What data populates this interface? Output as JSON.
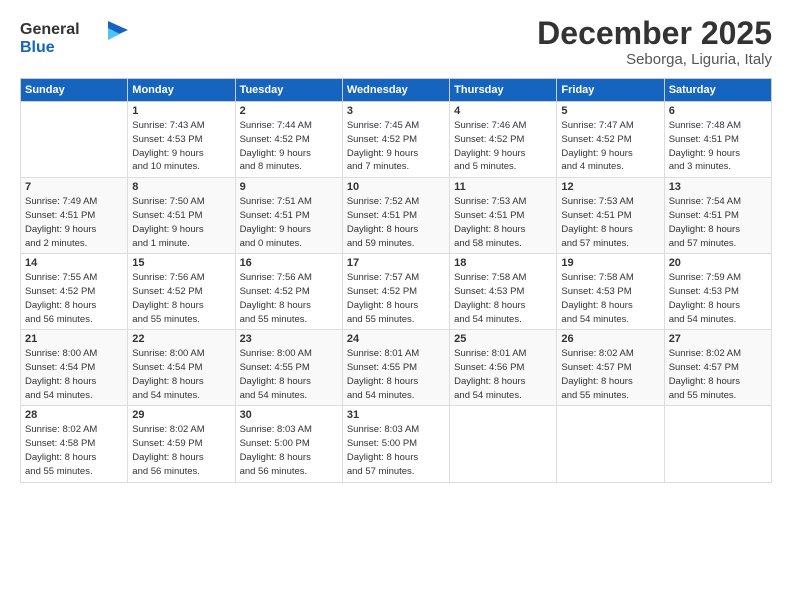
{
  "header": {
    "logo_line1": "General",
    "logo_line2": "Blue",
    "month": "December 2025",
    "location": "Seborga, Liguria, Italy"
  },
  "weekdays": [
    "Sunday",
    "Monday",
    "Tuesday",
    "Wednesday",
    "Thursday",
    "Friday",
    "Saturday"
  ],
  "weeks": [
    [
      {
        "day": "",
        "info": ""
      },
      {
        "day": "1",
        "info": "Sunrise: 7:43 AM\nSunset: 4:53 PM\nDaylight: 9 hours\nand 10 minutes."
      },
      {
        "day": "2",
        "info": "Sunrise: 7:44 AM\nSunset: 4:52 PM\nDaylight: 9 hours\nand 8 minutes."
      },
      {
        "day": "3",
        "info": "Sunrise: 7:45 AM\nSunset: 4:52 PM\nDaylight: 9 hours\nand 7 minutes."
      },
      {
        "day": "4",
        "info": "Sunrise: 7:46 AM\nSunset: 4:52 PM\nDaylight: 9 hours\nand 5 minutes."
      },
      {
        "day": "5",
        "info": "Sunrise: 7:47 AM\nSunset: 4:52 PM\nDaylight: 9 hours\nand 4 minutes."
      },
      {
        "day": "6",
        "info": "Sunrise: 7:48 AM\nSunset: 4:51 PM\nDaylight: 9 hours\nand 3 minutes."
      }
    ],
    [
      {
        "day": "7",
        "info": "Sunrise: 7:49 AM\nSunset: 4:51 PM\nDaylight: 9 hours\nand 2 minutes."
      },
      {
        "day": "8",
        "info": "Sunrise: 7:50 AM\nSunset: 4:51 PM\nDaylight: 9 hours\nand 1 minute."
      },
      {
        "day": "9",
        "info": "Sunrise: 7:51 AM\nSunset: 4:51 PM\nDaylight: 9 hours\nand 0 minutes."
      },
      {
        "day": "10",
        "info": "Sunrise: 7:52 AM\nSunset: 4:51 PM\nDaylight: 8 hours\nand 59 minutes."
      },
      {
        "day": "11",
        "info": "Sunrise: 7:53 AM\nSunset: 4:51 PM\nDaylight: 8 hours\nand 58 minutes."
      },
      {
        "day": "12",
        "info": "Sunrise: 7:53 AM\nSunset: 4:51 PM\nDaylight: 8 hours\nand 57 minutes."
      },
      {
        "day": "13",
        "info": "Sunrise: 7:54 AM\nSunset: 4:51 PM\nDaylight: 8 hours\nand 57 minutes."
      }
    ],
    [
      {
        "day": "14",
        "info": "Sunrise: 7:55 AM\nSunset: 4:52 PM\nDaylight: 8 hours\nand 56 minutes."
      },
      {
        "day": "15",
        "info": "Sunrise: 7:56 AM\nSunset: 4:52 PM\nDaylight: 8 hours\nand 55 minutes."
      },
      {
        "day": "16",
        "info": "Sunrise: 7:56 AM\nSunset: 4:52 PM\nDaylight: 8 hours\nand 55 minutes."
      },
      {
        "day": "17",
        "info": "Sunrise: 7:57 AM\nSunset: 4:52 PM\nDaylight: 8 hours\nand 55 minutes."
      },
      {
        "day": "18",
        "info": "Sunrise: 7:58 AM\nSunset: 4:53 PM\nDaylight: 8 hours\nand 54 minutes."
      },
      {
        "day": "19",
        "info": "Sunrise: 7:58 AM\nSunset: 4:53 PM\nDaylight: 8 hours\nand 54 minutes."
      },
      {
        "day": "20",
        "info": "Sunrise: 7:59 AM\nSunset: 4:53 PM\nDaylight: 8 hours\nand 54 minutes."
      }
    ],
    [
      {
        "day": "21",
        "info": "Sunrise: 8:00 AM\nSunset: 4:54 PM\nDaylight: 8 hours\nand 54 minutes."
      },
      {
        "day": "22",
        "info": "Sunrise: 8:00 AM\nSunset: 4:54 PM\nDaylight: 8 hours\nand 54 minutes."
      },
      {
        "day": "23",
        "info": "Sunrise: 8:00 AM\nSunset: 4:55 PM\nDaylight: 8 hours\nand 54 minutes."
      },
      {
        "day": "24",
        "info": "Sunrise: 8:01 AM\nSunset: 4:55 PM\nDaylight: 8 hours\nand 54 minutes."
      },
      {
        "day": "25",
        "info": "Sunrise: 8:01 AM\nSunset: 4:56 PM\nDaylight: 8 hours\nand 54 minutes."
      },
      {
        "day": "26",
        "info": "Sunrise: 8:02 AM\nSunset: 4:57 PM\nDaylight: 8 hours\nand 55 minutes."
      },
      {
        "day": "27",
        "info": "Sunrise: 8:02 AM\nSunset: 4:57 PM\nDaylight: 8 hours\nand 55 minutes."
      }
    ],
    [
      {
        "day": "28",
        "info": "Sunrise: 8:02 AM\nSunset: 4:58 PM\nDaylight: 8 hours\nand 55 minutes."
      },
      {
        "day": "29",
        "info": "Sunrise: 8:02 AM\nSunset: 4:59 PM\nDaylight: 8 hours\nand 56 minutes."
      },
      {
        "day": "30",
        "info": "Sunrise: 8:03 AM\nSunset: 5:00 PM\nDaylight: 8 hours\nand 56 minutes."
      },
      {
        "day": "31",
        "info": "Sunrise: 8:03 AM\nSunset: 5:00 PM\nDaylight: 8 hours\nand 57 minutes."
      },
      {
        "day": "",
        "info": ""
      },
      {
        "day": "",
        "info": ""
      },
      {
        "day": "",
        "info": ""
      }
    ]
  ]
}
